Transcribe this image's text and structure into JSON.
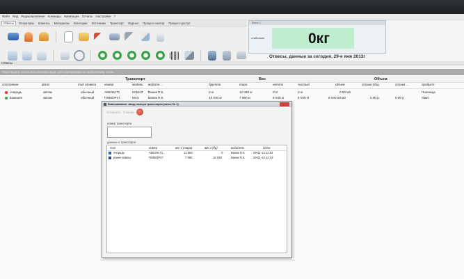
{
  "menu": [
    "Файл",
    "Вид",
    "Редактирование",
    "Команды",
    "Навигация",
    "Отчеты",
    "Настройки",
    "?"
  ],
  "tabs": [
    "Отвесы",
    "Операторы",
    "Клиенты",
    "Материалы",
    "Категории",
    "Источники",
    "Транспорт",
    "Журнал",
    "Процесс-кантор",
    "Процесс-доступ"
  ],
  "scale": {
    "header": "Весы 1",
    "weight": "0кг",
    "status": "стабильно",
    "caption": "Отвесы, данные  за сегодня, 29-е янв 2013г"
  },
  "section_title": "Отвесы",
  "hint": "Перетащите заголовок колонки сюда, для группировки по выбранному полю",
  "groups": {
    "transport": "Транспорт",
    "weight": "Вес",
    "volume": "Объем"
  },
  "columns": [
    "состояние",
    "флаг",
    "тип отвеса",
    "номер",
    "модель",
    "водите...",
    "брутто",
    "тара",
    "нетто",
    "чистый",
    "объем",
    "стоим общ.",
    "стоим ...",
    "продукт"
  ],
  "rows": [
    {
      "state": "очередь",
      "flag": "автом",
      "type": "обычный",
      "number": "А853НА71",
      "model": "КАМАЗ",
      "driver": "Ваник П.К.",
      "brutto": "0 кг",
      "tara": "12 060 кг",
      "netto": "0 кг",
      "clean": "0 кг",
      "volume": "0.00 м3",
      "cost": "",
      "cost2": "",
      "product": "Пшеница"
    },
    {
      "state": "взвешен",
      "flag": "автом",
      "type": "обычный",
      "number": "П456ОР47",
      "model": "МАЗ",
      "driver": "Ваник П.К.",
      "brutto": "16 030 кг",
      "tara": "7 990 кг",
      "netto": "8 040 кг",
      "clean": "8 040 кг",
      "volume": "8 040.00 м3",
      "cost": "0.00 р.",
      "cost2": "0.00 р.",
      "product": "Овес"
    }
  ],
  "dialog": {
    "title": "Взвешивание: ввод номера транспорта (весы № 1)",
    "tools": [
      "Отменить",
      "Отмена"
    ],
    "plate_label": "номер транспорта",
    "plate_value": "",
    "data_label": "данные о транспорте",
    "columns": [
      "тип",
      "номер",
      "вес 1 (тара)",
      "вес 2 (бр)",
      "водитель",
      "дата"
    ],
    "rows": [
      {
        "type": "очередь",
        "number": "А853НА71",
        "w1": "12 060",
        "w2": "0",
        "driver": "Ваник П.К.",
        "date": "29-01-13 12:54"
      },
      {
        "type": "ранее взвеш.",
        "number": "П456ОР47",
        "w1": "7 990",
        "w2": "16 030",
        "driver": "Ваник П.К.",
        "date": "29-01-13 12:43"
      }
    ]
  },
  "colors": {
    "accent_green": "#bfeecf",
    "queue_dot": "#e0342c",
    "weighed_dot": "#36a852"
  }
}
